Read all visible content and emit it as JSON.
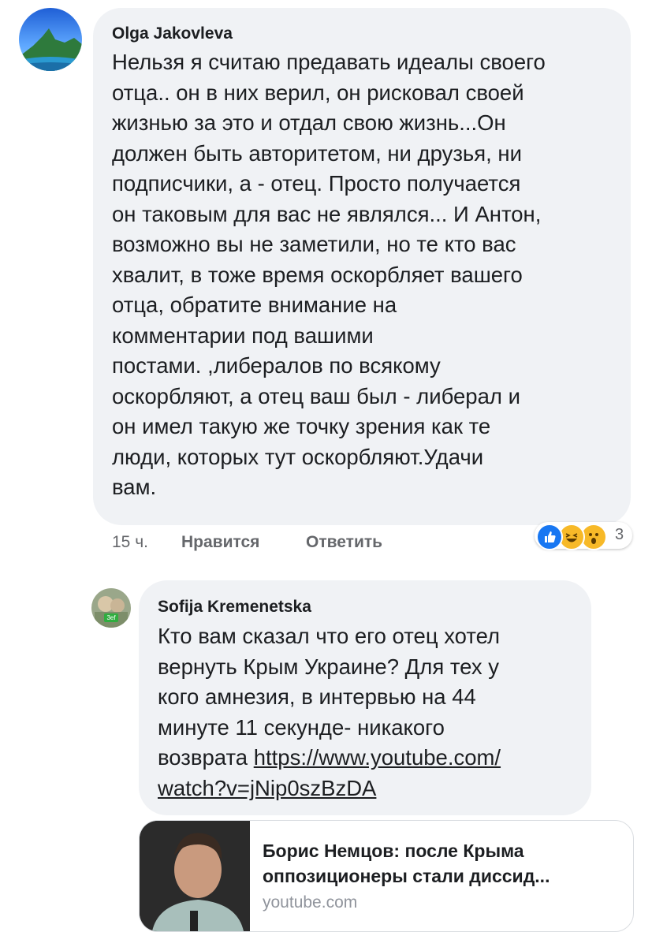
{
  "comments": [
    {
      "author": "Olga Jakovleva",
      "text": "Нельзя я считаю предавать идеалы своего\nотца.. он в них верил, он рисковал своей\nжизнью за это и отдал свою жизнь...Он\nдолжен быть авторитетом, ни друзья, ни\nподписчики, а -  отец. Просто получается\nон таковым для вас не являлся... И Антон,\nвозможно вы не заметили, но те кто вас\nхвалит, в тоже время оскорбляет вашего\nотца, обратите внимание на\nкомментарии  под вашими\nпостами. ,либералов по всякому\nоскорбляют,  а отец ваш был - либерал и\nон имел такую же точку зрения как те\nлюди, которых тут оскорбляют.Удачи\nвам.",
      "time": "15 ч.",
      "like_label": "Нравится",
      "reply_label": "Ответить",
      "reactions": [
        "like-icon",
        "laugh-icon",
        "wow-icon"
      ],
      "reaction_count": "3"
    },
    {
      "author": "Sofija Kremenetska",
      "avatar_badge": "3ef",
      "text": "Кто вам сказал что его отец хотел\nвернуть Крым Украине? Для тех у\nкого амнезия, в интервью на 44\nминуте 11 секунде- никакого\nвозврата ",
      "link_line1": "https://www.youtube.com/",
      "link_line2": "watch?v=jNip0szBzDA"
    }
  ],
  "link_preview": {
    "title": "Борис Немцов: после Крыма оппозиционеры стали диссид...",
    "domain": "youtube.com"
  },
  "colors": {
    "bubble": "#f0f2f5",
    "meta_text": "#65676b",
    "like_blue": "#1877f2",
    "emoji_yellow": "#f7b928"
  }
}
